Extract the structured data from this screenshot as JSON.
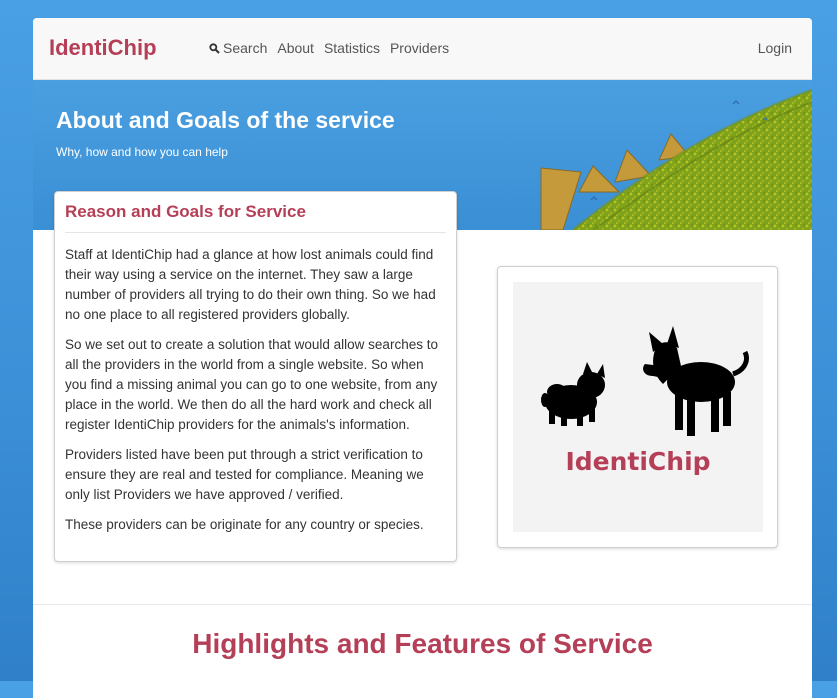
{
  "navbar": {
    "brand": "IdentiChip",
    "links": [
      {
        "label": "Search",
        "icon": "search-icon"
      },
      {
        "label": "About"
      },
      {
        "label": "Statistics"
      },
      {
        "label": "Providers"
      }
    ],
    "login_label": "Login"
  },
  "hero": {
    "title": "About and Goals of the service",
    "subtitle": "Why, how and how you can help"
  },
  "reason_panel": {
    "title": "Reason and Goals for Service",
    "paragraphs": [
      "Staff at IdentiChip had a glance at how lost animals could find their way using a service on the internet. They saw a large number of providers all trying to do their own thing. So we had no one place to all registered providers globally.",
      "So we set out to create a solution that would allow searches to all the providers in the world from a single website. So when you find a missing animal you can go to one website, from any place in the world. We then do all the hard work and check all register IdentiChip providers for the animals's information.",
      "Providers listed have been put through a strict verification to ensure they are real and tested for compliance. Meaning we only list Providers we have approved / verified.",
      "These providers can be originate for any country or species."
    ]
  },
  "logo_card": {
    "logo_text": "IdentiChip"
  },
  "highlights": {
    "title": "Highlights and Features of Service"
  },
  "colors": {
    "brand": "#b53f57",
    "hero_blue": "#4a9fe0",
    "background_blue": "#3b8fd6"
  }
}
